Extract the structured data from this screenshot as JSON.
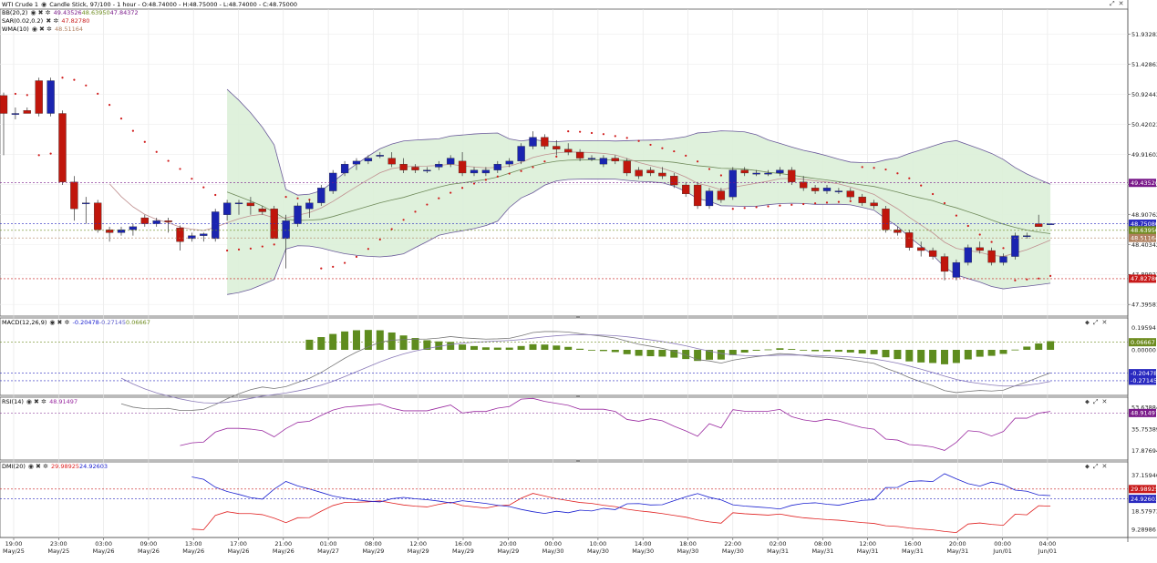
{
  "header": {
    "symbol": "WTI Crude 1",
    "meta": "Candle Stick, 97/100 - 1 hour - O:48.74000 - H:48.75000 - L:48.74000 - C:48.75000"
  },
  "legends": {
    "bb": {
      "name": "BB(20,2)",
      "values": [
        "49.43526",
        "48.63950",
        "47.84372"
      ]
    },
    "sar": {
      "name": "SAR(0.02,0.2)",
      "value": "47.82780"
    },
    "wma": {
      "name": "WMA(10)",
      "value": "48.51164"
    },
    "macd": {
      "name": "MACD(12,26,9)",
      "values": [
        "-0.20478",
        "-0.27145",
        "0.06667"
      ]
    },
    "rsi": {
      "name": "RSI(14)",
      "value": "48.91497"
    },
    "dmi": {
      "name": "DMI(20)",
      "values": [
        "29.98925",
        "24.92603"
      ]
    }
  },
  "colors": {
    "bull": "#1a24b0",
    "bear": "#c0160c",
    "band_fill": "#dcefd8",
    "band_line": "#6a5a9a",
    "mid_line": "#6f8a5a",
    "wma": "#c09090",
    "sar": "#d01a1a",
    "macd_hist": "#5e8c1e",
    "macd_line": "#8a7ab8",
    "macd_signal": "#777777",
    "rsi": "#9a2aa0",
    "dmi_plus": "#e02020",
    "dmi_minus": "#1a20d0",
    "tag_blue": "#2a2ac0",
    "tag_purple": "#7a1a8a",
    "tag_red": "#c81a1a",
    "tag_green": "#6e8c20",
    "tag_tan": "#b08060"
  },
  "chart_data": {
    "type": "candlestick",
    "price_axis": {
      "range": [
        47.2,
        52.35
      ],
      "ticks": [
        "51.93283",
        "51.42863",
        "50.92443",
        "50.42023",
        "49.91602",
        "49.40762",
        "48.90762",
        "48.40342",
        "47.89922",
        "47.39581"
      ],
      "tick_values": [
        51.93283,
        51.42863,
        50.92443,
        50.42023,
        49.91602,
        49.40762,
        48.90762,
        48.40342,
        47.89922,
        47.39581
      ],
      "tags": [
        {
          "label": "49.43526",
          "value": 49.43526,
          "color": "tag_purple"
        },
        {
          "label": "48.75080",
          "value": 48.7508,
          "color": "tag_blue"
        },
        {
          "label": "48.63950",
          "value": 48.6395,
          "color": "tag_green"
        },
        {
          "label": "48.51164",
          "value": 48.51164,
          "color": "tag_tan"
        },
        {
          "label": "47.82780",
          "value": 47.8278,
          "color": "tag_red"
        }
      ]
    },
    "time_axis": [
      {
        "time": "19:00",
        "date": "May/25"
      },
      {
        "time": "23:00",
        "date": "May/25"
      },
      {
        "time": "03:00",
        "date": "May/26"
      },
      {
        "time": "09:00",
        "date": "May/26"
      },
      {
        "time": "13:00",
        "date": "May/26"
      },
      {
        "time": "17:00",
        "date": "May/26"
      },
      {
        "time": "21:00",
        "date": "May/26"
      },
      {
        "time": "01:00",
        "date": "May/27"
      },
      {
        "time": "08:00",
        "date": "May/29"
      },
      {
        "time": "12:00",
        "date": "May/29"
      },
      {
        "time": "16:00",
        "date": "May/29"
      },
      {
        "time": "20:00",
        "date": "May/29"
      },
      {
        "time": "00:00",
        "date": "May/30"
      },
      {
        "time": "10:00",
        "date": "May/30"
      },
      {
        "time": "14:00",
        "date": "May/30"
      },
      {
        "time": "18:00",
        "date": "May/30"
      },
      {
        "time": "22:00",
        "date": "May/30"
      },
      {
        "time": "02:00",
        "date": "May/31"
      },
      {
        "time": "08:00",
        "date": "May/31"
      },
      {
        "time": "12:00",
        "date": "May/31"
      },
      {
        "time": "16:00",
        "date": "May/31"
      },
      {
        "time": "20:00",
        "date": "May/31"
      },
      {
        "time": "00:00",
        "date": "Jun/01"
      },
      {
        "time": "04:00",
        "date": "Jun/01"
      }
    ],
    "candles": [
      [
        50.9,
        50.95,
        49.9,
        50.6
      ],
      [
        50.6,
        50.7,
        50.5,
        50.6
      ],
      [
        50.65,
        50.7,
        50.6,
        50.6
      ],
      [
        51.15,
        51.2,
        50.55,
        50.6
      ],
      [
        50.6,
        51.2,
        50.55,
        51.15
      ],
      [
        50.6,
        50.65,
        49.4,
        49.45
      ],
      [
        49.45,
        49.55,
        48.8,
        49.0
      ],
      [
        49.1,
        49.2,
        48.75,
        49.1
      ],
      [
        49.1,
        49.15,
        48.6,
        48.65
      ],
      [
        48.65,
        48.7,
        48.45,
        48.6
      ],
      [
        48.6,
        48.7,
        48.55,
        48.65
      ],
      [
        48.65,
        48.75,
        48.55,
        48.7
      ],
      [
        48.85,
        48.9,
        48.7,
        48.75
      ],
      [
        48.75,
        48.85,
        48.7,
        48.8
      ],
      [
        48.8,
        48.85,
        48.6,
        48.78
      ],
      [
        48.68,
        48.72,
        48.3,
        48.45
      ],
      [
        48.5,
        48.6,
        48.45,
        48.55
      ],
      [
        48.55,
        48.6,
        48.45,
        48.58
      ],
      [
        48.5,
        49.0,
        48.45,
        48.95
      ],
      [
        48.9,
        49.15,
        48.8,
        49.1
      ],
      [
        49.1,
        49.15,
        48.9,
        49.1
      ],
      [
        49.1,
        49.2,
        48.9,
        49.05
      ],
      [
        49.0,
        49.05,
        48.9,
        48.95
      ],
      [
        49.0,
        49.05,
        48.5,
        48.5
      ],
      [
        48.5,
        48.9,
        48.0,
        48.8
      ],
      [
        48.75,
        49.1,
        48.7,
        49.05
      ],
      [
        49.0,
        49.15,
        48.85,
        49.1
      ],
      [
        49.1,
        49.4,
        49.05,
        49.35
      ],
      [
        49.3,
        49.65,
        49.25,
        49.6
      ],
      [
        49.6,
        49.8,
        49.55,
        49.75
      ],
      [
        49.75,
        49.85,
        49.65,
        49.8
      ],
      [
        49.8,
        49.9,
        49.75,
        49.85
      ],
      [
        49.9,
        49.95,
        49.85,
        49.9
      ],
      [
        49.85,
        49.95,
        49.7,
        49.75
      ],
      [
        49.75,
        49.85,
        49.6,
        49.65
      ],
      [
        49.7,
        49.75,
        49.6,
        49.65
      ],
      [
        49.65,
        49.7,
        49.6,
        49.65
      ],
      [
        49.7,
        49.8,
        49.65,
        49.75
      ],
      [
        49.75,
        49.9,
        49.7,
        49.85
      ],
      [
        49.8,
        49.95,
        49.55,
        49.6
      ],
      [
        49.6,
        49.7,
        49.55,
        49.65
      ],
      [
        49.6,
        49.7,
        49.55,
        49.65
      ],
      [
        49.65,
        49.8,
        49.6,
        49.75
      ],
      [
        49.75,
        49.85,
        49.7,
        49.8
      ],
      [
        49.8,
        50.1,
        49.75,
        50.05
      ],
      [
        50.05,
        50.3,
        50.0,
        50.2
      ],
      [
        50.2,
        50.25,
        50.0,
        50.05
      ],
      [
        50.05,
        50.15,
        49.9,
        50.0
      ],
      [
        50.0,
        50.1,
        49.9,
        49.95
      ],
      [
        49.95,
        50.0,
        49.8,
        49.85
      ],
      [
        49.85,
        49.9,
        49.8,
        49.85
      ],
      [
        49.75,
        49.9,
        49.7,
        49.85
      ],
      [
        49.85,
        49.9,
        49.75,
        49.8
      ],
      [
        49.8,
        49.85,
        49.55,
        49.6
      ],
      [
        49.65,
        49.7,
        49.5,
        49.55
      ],
      [
        49.65,
        49.7,
        49.55,
        49.6
      ],
      [
        49.6,
        49.7,
        49.5,
        49.55
      ],
      [
        49.55,
        49.6,
        49.35,
        49.4
      ],
      [
        49.4,
        49.45,
        49.2,
        49.25
      ],
      [
        49.4,
        49.45,
        49.0,
        49.05
      ],
      [
        49.05,
        49.35,
        49.0,
        49.3
      ],
      [
        49.3,
        49.35,
        49.1,
        49.15
      ],
      [
        49.2,
        49.7,
        49.15,
        49.65
      ],
      [
        49.65,
        49.7,
        49.55,
        49.6
      ],
      [
        49.6,
        49.65,
        49.55,
        49.6
      ],
      [
        49.6,
        49.65,
        49.55,
        49.6
      ],
      [
        49.6,
        49.7,
        49.55,
        49.65
      ],
      [
        49.65,
        49.7,
        49.4,
        49.45
      ],
      [
        49.45,
        49.55,
        49.3,
        49.35
      ],
      [
        49.35,
        49.4,
        49.25,
        49.3
      ],
      [
        49.3,
        49.4,
        49.25,
        49.35
      ],
      [
        49.3,
        49.35,
        49.25,
        49.3
      ],
      [
        49.3,
        49.35,
        49.15,
        49.2
      ],
      [
        49.2,
        49.25,
        49.05,
        49.1
      ],
      [
        49.1,
        49.15,
        49.0,
        49.05
      ],
      [
        49.0,
        49.05,
        48.6,
        48.65
      ],
      [
        48.65,
        48.7,
        48.55,
        48.6
      ],
      [
        48.6,
        48.65,
        48.3,
        48.35
      ],
      [
        48.35,
        48.45,
        48.2,
        48.3
      ],
      [
        48.3,
        48.35,
        48.15,
        48.2
      ],
      [
        48.2,
        48.25,
        47.8,
        47.95
      ],
      [
        47.85,
        48.15,
        47.8,
        48.1
      ],
      [
        48.1,
        48.4,
        48.05,
        48.35
      ],
      [
        48.35,
        48.45,
        48.25,
        48.3
      ],
      [
        48.3,
        48.35,
        48.05,
        48.1
      ],
      [
        48.1,
        48.25,
        48.05,
        48.2
      ],
      [
        48.2,
        48.6,
        48.15,
        48.55
      ],
      [
        48.55,
        48.6,
        48.5,
        48.55
      ],
      [
        48.75,
        48.9,
        48.7,
        48.7
      ],
      [
        48.74,
        48.75,
        48.74,
        48.75
      ]
    ],
    "macd_axis": {
      "ticks": [
        "0.19594",
        "0.00000"
      ],
      "tick_values": [
        0.19594,
        0
      ]
    },
    "rsi_axis": {
      "ticks": [
        "53.63884",
        "35.75389",
        "17.87694"
      ],
      "tick_values": [
        53.63884,
        35.75389,
        17.87694
      ]
    },
    "dmi_axis": {
      "ticks": [
        "37.15946",
        "18.57973",
        "9.28986"
      ],
      "tick_values": [
        37.15946,
        18.57973,
        9.28986
      ]
    },
    "macd_tags": [
      {
        "label": "0.06667",
        "value": 0.06667,
        "color": "tag_green"
      },
      {
        "label": "-0.20478",
        "value": -0.20478,
        "color": "tag_blue"
      },
      {
        "label": "-0.27145",
        "value": -0.27145,
        "color": "tag_blue"
      }
    ],
    "rsi_tags": [
      {
        "label": "48.91497",
        "value": 48.91497,
        "color": "tag_purple"
      }
    ],
    "dmi_tags": [
      {
        "label": "29.98925",
        "value": 29.98925,
        "color": "tag_red"
      },
      {
        "label": "24.92603",
        "value": 24.92603,
        "color": "tag_blue"
      }
    ]
  }
}
